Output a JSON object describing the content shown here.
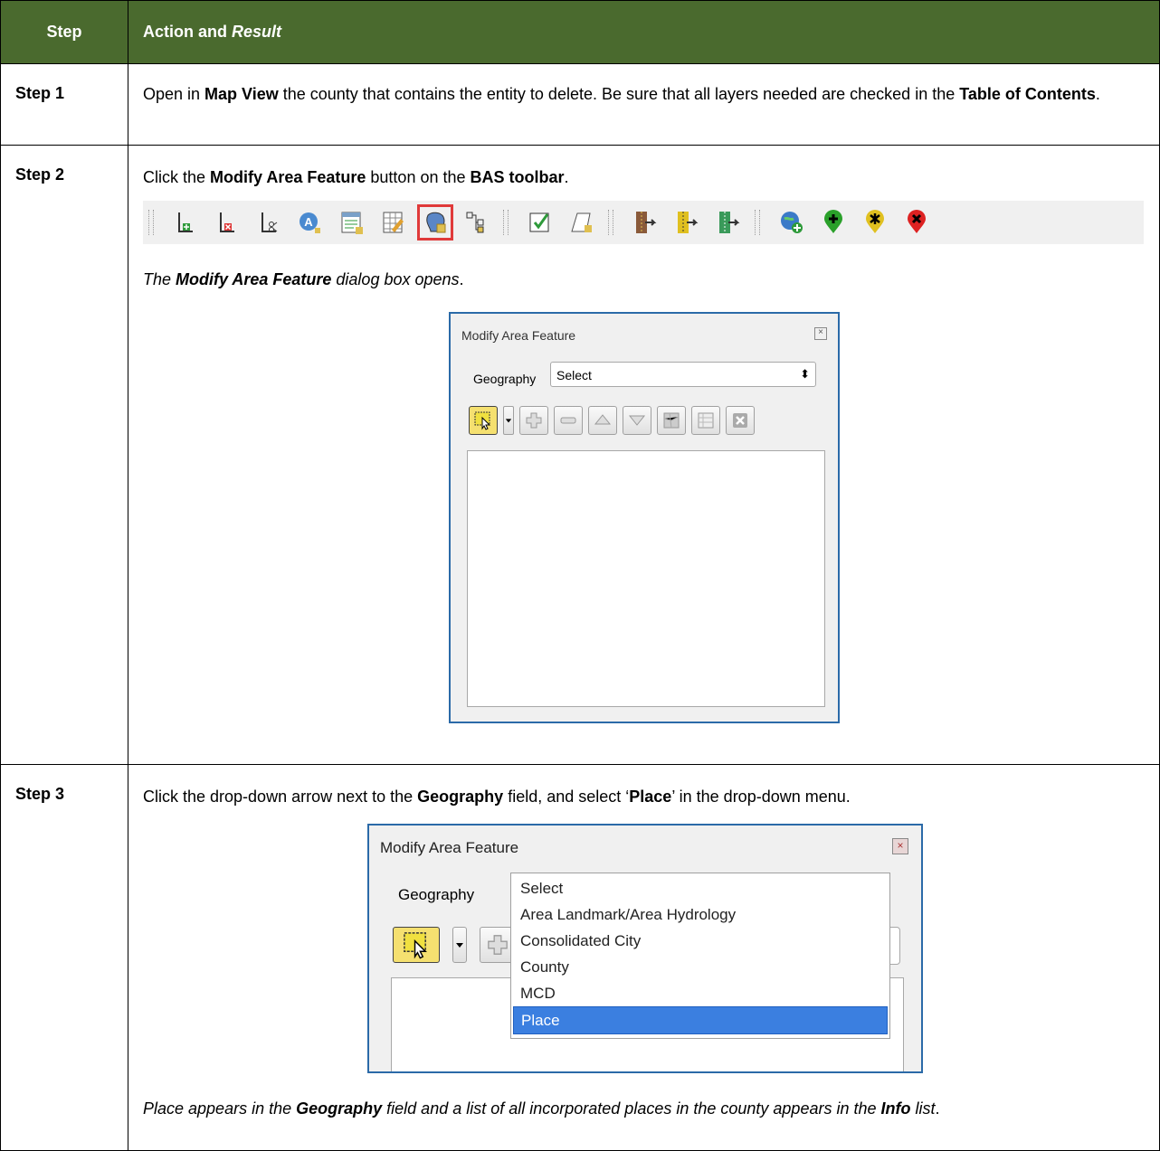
{
  "header": {
    "step": "Step",
    "action": "Action and",
    "result": "Result"
  },
  "step1": {
    "label": "Step 1",
    "t1": "Open in ",
    "b1": "Map View",
    "t2": " the county that contains the entity to delete. Be sure that all layers needed are checked in the ",
    "b2": "Table of Contents",
    "t3": "."
  },
  "step2": {
    "label": "Step 2",
    "t1": "Click the ",
    "b1": "Modify Area Feature",
    "t2": " button on the ",
    "b2": "BAS toolbar",
    "t3": ".",
    "r_bold": "Modify Area Feature",
    "r_pre": "The ",
    "r_post": " dialog box opens",
    "r_end": "."
  },
  "dialog1": {
    "title": "Modify Area Feature",
    "geo_label": "Geography",
    "select_value": "Select"
  },
  "step3": {
    "label": "Step 3",
    "t1": "Click the drop-down arrow next to the ",
    "b1": "Geography",
    "t2": " field, and select ‘",
    "b2": "Place",
    "t3": "’ in the drop-down menu.",
    "r1": "Place appears in the ",
    "rb1": "Geography",
    "r2": " field and a list of all incorporated places in the county appears in the ",
    "rb2": "Info",
    "r3": " list",
    "r4": "."
  },
  "dialog2": {
    "title": "Modify Area Feature",
    "geo_label": "Geography",
    "options": [
      "Select",
      "Area Landmark/Area Hydrology",
      "Consolidated City",
      "County",
      "MCD",
      "Place"
    ],
    "selected": "Place"
  },
  "toolbar": {
    "icons": [
      "add-line-icon",
      "delete-line-icon",
      "split-line-icon",
      "add-area-landmark-icon",
      "new-feature-table-icon",
      "edit-table-icon",
      "modify-area-feature-icon",
      "topology-icon",
      "validate-icon",
      "new-polygon-icon",
      "import-boundary-icon",
      "import-boundary-yellow-icon",
      "export-boundary-icon",
      "add-web-map-icon",
      "add-point-icon",
      "modify-point-icon",
      "delete-point-icon"
    ],
    "highlighted": "modify-area-feature-icon"
  },
  "colors": {
    "header_bg": "#4a6a2e",
    "highlight": "#e03a3a",
    "selection": "#3b7fe0",
    "dialog_border": "#2b6aa8"
  }
}
